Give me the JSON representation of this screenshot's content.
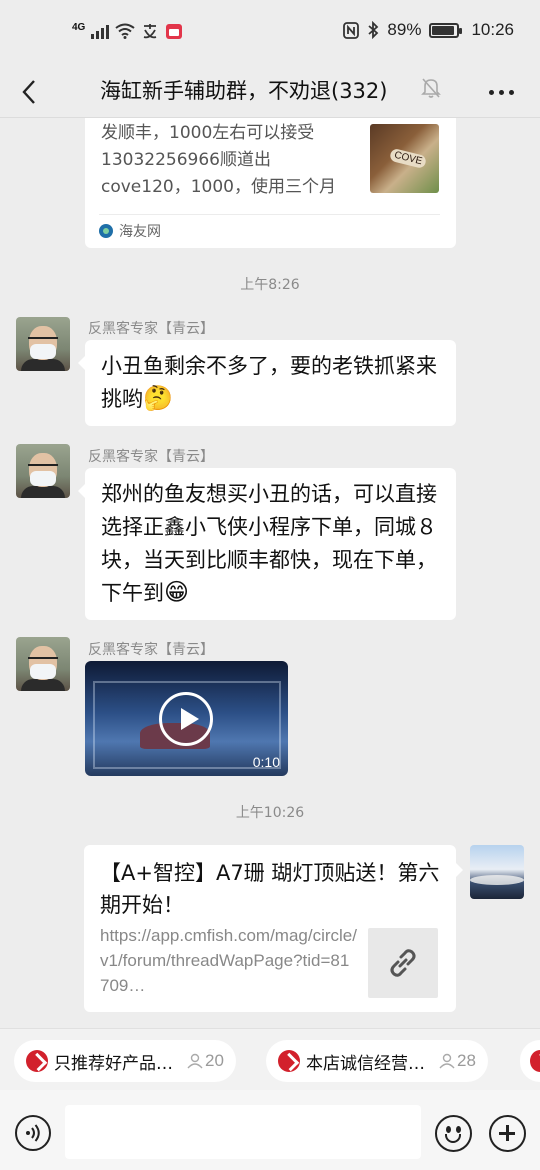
{
  "status_bar": {
    "network": "4G",
    "battery": "89%",
    "battery_level": 0.89,
    "time": "10:26"
  },
  "header": {
    "title": "海缸新手辅助群，不劝退(332)"
  },
  "chat": {
    "top_card": {
      "text": "发顺丰，1000左右可以接受13032256966顺道出cove120，1000，使用三个月",
      "thumb_label": "COVE",
      "source": "海友网"
    },
    "timestamp_1": "上午8:26",
    "messages": [
      {
        "sender": "反黑客专家【青云】",
        "text": "小丑鱼剩余不多了，要的老铁抓紧来挑哟",
        "emoji": "🤔"
      },
      {
        "sender": "反黑客专家【青云】",
        "text": "郑州的鱼友想买小丑的话，可以直接选择正鑫小飞侠小程序下单，同城８块，当天到比顺丰都快，现在下单，下午到",
        "emoji": "😁"
      },
      {
        "sender": "反黑客专家【青云】",
        "video_duration": "0:10"
      }
    ],
    "timestamp_2": "上午10:26",
    "link_message": {
      "title": "【A+智控】A7珊 瑚灯顶贴送！第六期开始！",
      "url": "https://app.cmfish.com/mag/circle/v1/forum/threadWapPage?tid=81709…"
    }
  },
  "shelf": {
    "chips": [
      {
        "label": "只推荐好产品…",
        "count": "20"
      },
      {
        "label": "本店诚信经营…",
        "count": "28"
      }
    ]
  },
  "input": {
    "placeholder": ""
  },
  "colors": {
    "background": "#ededed",
    "bubble": "#ffffff",
    "brand_red": "#d2212c"
  }
}
